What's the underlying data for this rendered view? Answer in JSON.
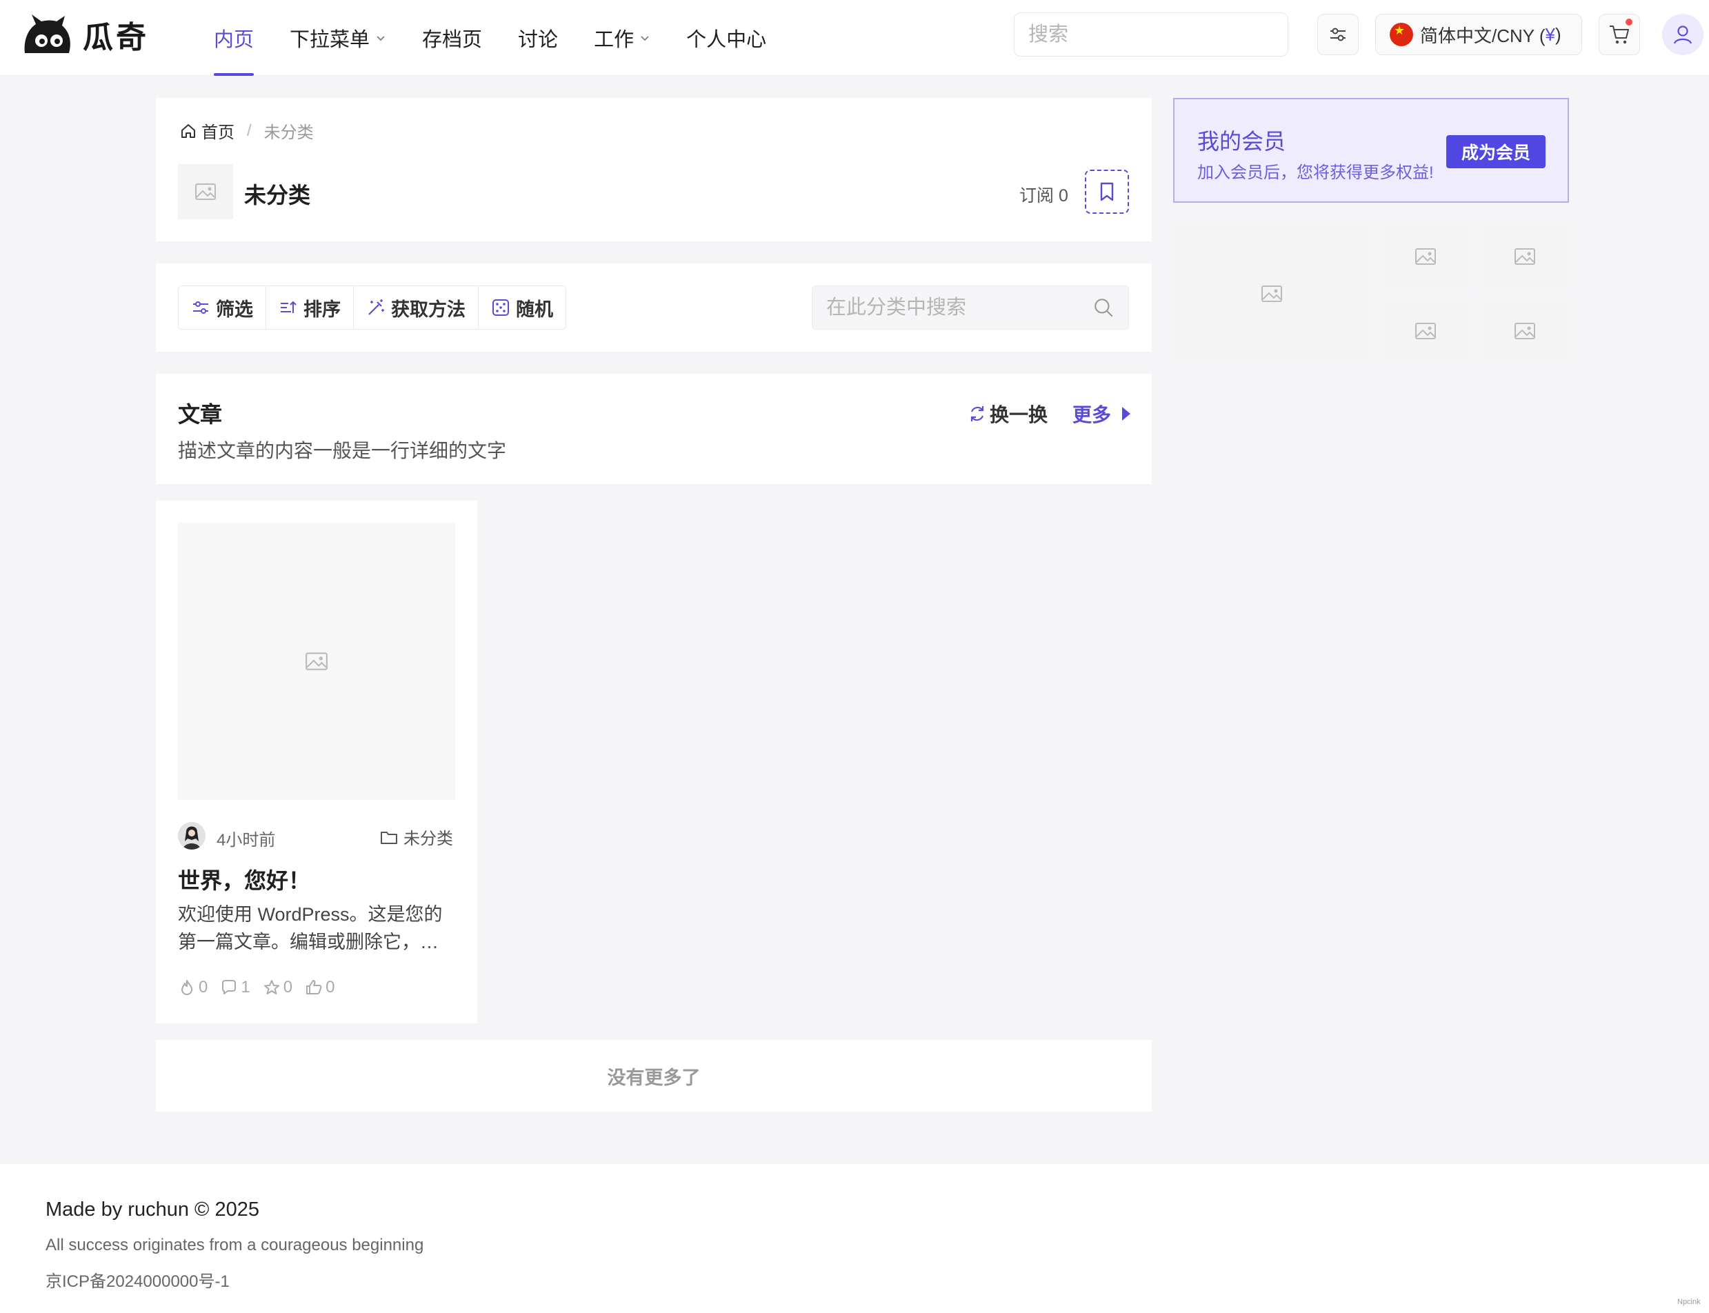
{
  "header": {
    "logo_text": "瓜奇",
    "nav": [
      {
        "label": "内页",
        "active": true,
        "dropdown": false
      },
      {
        "label": "下拉菜单",
        "active": false,
        "dropdown": true
      },
      {
        "label": "存档页",
        "active": false,
        "dropdown": false
      },
      {
        "label": "讨论",
        "active": false,
        "dropdown": false
      },
      {
        "label": "工作",
        "active": false,
        "dropdown": true
      },
      {
        "label": "个人中心",
        "active": false,
        "dropdown": false
      }
    ],
    "search_placeholder": "搜索",
    "language": {
      "label": "简体中文/CNY (",
      "currency": "¥",
      "close": ")"
    }
  },
  "category": {
    "breadcrumb": {
      "home": "首页",
      "current": "未分类"
    },
    "title": "未分类",
    "subscribe_label": "订阅 0"
  },
  "toolbar": {
    "tools": [
      "筛选",
      "排序",
      "获取方法",
      "随机"
    ],
    "search_placeholder": "在此分类中搜索"
  },
  "section": {
    "title": "文章",
    "description": "描述文章的内容一般是一行详细的文字",
    "refresh_label": "换一换",
    "more_label": "更多"
  },
  "post": {
    "time": "4小时前",
    "category": "未分类",
    "title": "世界，您好！",
    "excerpt": "欢迎使用 WordPress。这是您的第一篇文章。编辑或删除它，…",
    "stats": {
      "hot": "0",
      "comments": "1",
      "favorites": "0",
      "likes": "0"
    }
  },
  "no_more": "没有更多了",
  "vip": {
    "title": "我的会员",
    "subtitle": "加入会员后，您将获得更多权益!",
    "button": "成为会员"
  },
  "footer": {
    "line1": "Made by ruchun © 2025",
    "line2": "All success originates from a courageous beginning",
    "icp": "京ICP备2024000000号-1",
    "watermark": "Npcink"
  },
  "colors": {
    "accent": "#5a4bd6",
    "vip_bg": "#eeecfd",
    "vip_button": "#5147e3"
  },
  "icons": [
    "search-icon",
    "settings-sliders-icon",
    "flag-cn-icon",
    "cart-icon",
    "user-icon",
    "home-icon",
    "image-placeholder-icon",
    "bookmark-icon",
    "filter-icon",
    "sort-icon",
    "magic-wand-icon",
    "dice-icon",
    "refresh-icon",
    "caret-right-icon",
    "folder-icon",
    "fire-icon",
    "comment-icon",
    "star-icon",
    "thumb-up-icon"
  ]
}
